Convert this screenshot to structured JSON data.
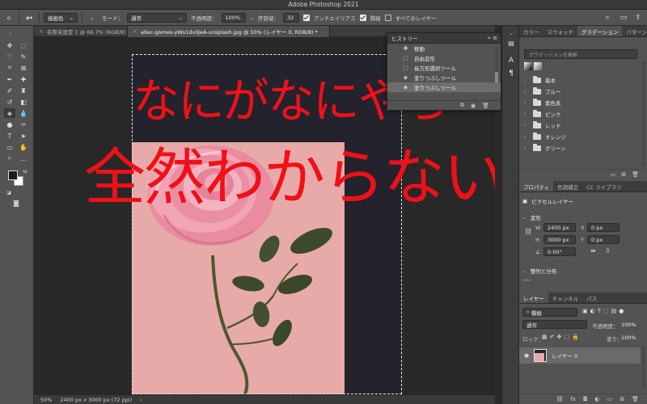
{
  "window": {
    "title": "Adobe Photoshop 2021"
  },
  "options_bar": {
    "home_glyph": "⌂",
    "fill_source": "描画色",
    "mode_label": "モード：",
    "mode_value": "通常",
    "opacity_label": "不透明度：",
    "opacity_value": "100%",
    "tolerance_label": "許容値：",
    "tolerance_value": "32",
    "antialias_label": "アンチエイリアス",
    "antialias_checked": true,
    "contiguous_label": "隣接",
    "contiguous_checked": true,
    "all_layers_label": "すべてのレイヤー",
    "all_layers_checked": false
  },
  "document_tabs": [
    {
      "label": "名称未設定 1 @ 66.7% (RGB/8)",
      "active": false
    },
    {
      "label": "allec-gomes-yWo1dxIljeA-unsplash.jpg @ 50% (レイヤー 0, RGB/8) *",
      "active": true
    }
  ],
  "canvas": {
    "overlay_line1": "なにがなにやら",
    "overlay_line2": "全然わからない",
    "overlay_color": "#f01018",
    "background_dark": "#23222d",
    "background_pink": "#e7aaa8"
  },
  "status_bar": {
    "zoom": "50%",
    "dimensions": "2400 px x 3000 px (72 ppi)"
  },
  "history_panel": {
    "title": "ヒストリー",
    "items": [
      {
        "label": "移動",
        "icon": "move-icon",
        "glyph": "✥",
        "selected": false
      },
      {
        "label": "自由変形",
        "icon": "transform-icon",
        "glyph": "⬚",
        "selected": false
      },
      {
        "label": "長方形選択ツール",
        "icon": "marquee-icon",
        "glyph": "⬚",
        "selected": false
      },
      {
        "label": "塗りつぶしツール",
        "icon": "bucket-icon",
        "glyph": "◈",
        "selected": false
      },
      {
        "label": "塗りつぶしツール",
        "icon": "bucket-icon",
        "glyph": "◈",
        "selected": true
      }
    ]
  },
  "gradient_panel": {
    "tabs": [
      {
        "label": "カラー",
        "active": false
      },
      {
        "label": "スウォッチ",
        "active": false
      },
      {
        "label": "グラデーション",
        "active": true
      },
      {
        "label": "パターン",
        "active": false
      }
    ],
    "search_placeholder": "グラデーションを検索",
    "folders": [
      "基本",
      "ブルー",
      "紫色系",
      "ピンク",
      "レッド",
      "オレンジ",
      "グリーン"
    ]
  },
  "properties_panel": {
    "tabs": [
      {
        "label": "プロパティ",
        "active": true
      },
      {
        "label": "色調補正",
        "active": false
      },
      {
        "label": "CC ライブラリ",
        "active": false
      }
    ],
    "layer_type": "ピクセルレイヤー",
    "transform_heading": "変形",
    "w_label": "W",
    "w_value": "2400 px",
    "h_label": "H",
    "h_value": "3000 px",
    "x_label": "X",
    "x_value": "0 px",
    "y_label": "Y",
    "y_value": "0 px",
    "angle_value": "0.00°",
    "align_heading": "整列と分布"
  },
  "layers_panel": {
    "tabs": [
      {
        "label": "レイヤー",
        "active": true
      },
      {
        "label": "チャンネル",
        "active": false
      },
      {
        "label": "パス",
        "active": false
      }
    ],
    "filter_value": "種類",
    "blend_mode": "通常",
    "opacity_label": "不透明度：",
    "opacity_value": "100%",
    "lock_label": "ロック：",
    "fill_label": "塗り：",
    "fill_value": "100%",
    "layers": [
      {
        "name": "レイヤー 0",
        "visible": true
      }
    ]
  }
}
